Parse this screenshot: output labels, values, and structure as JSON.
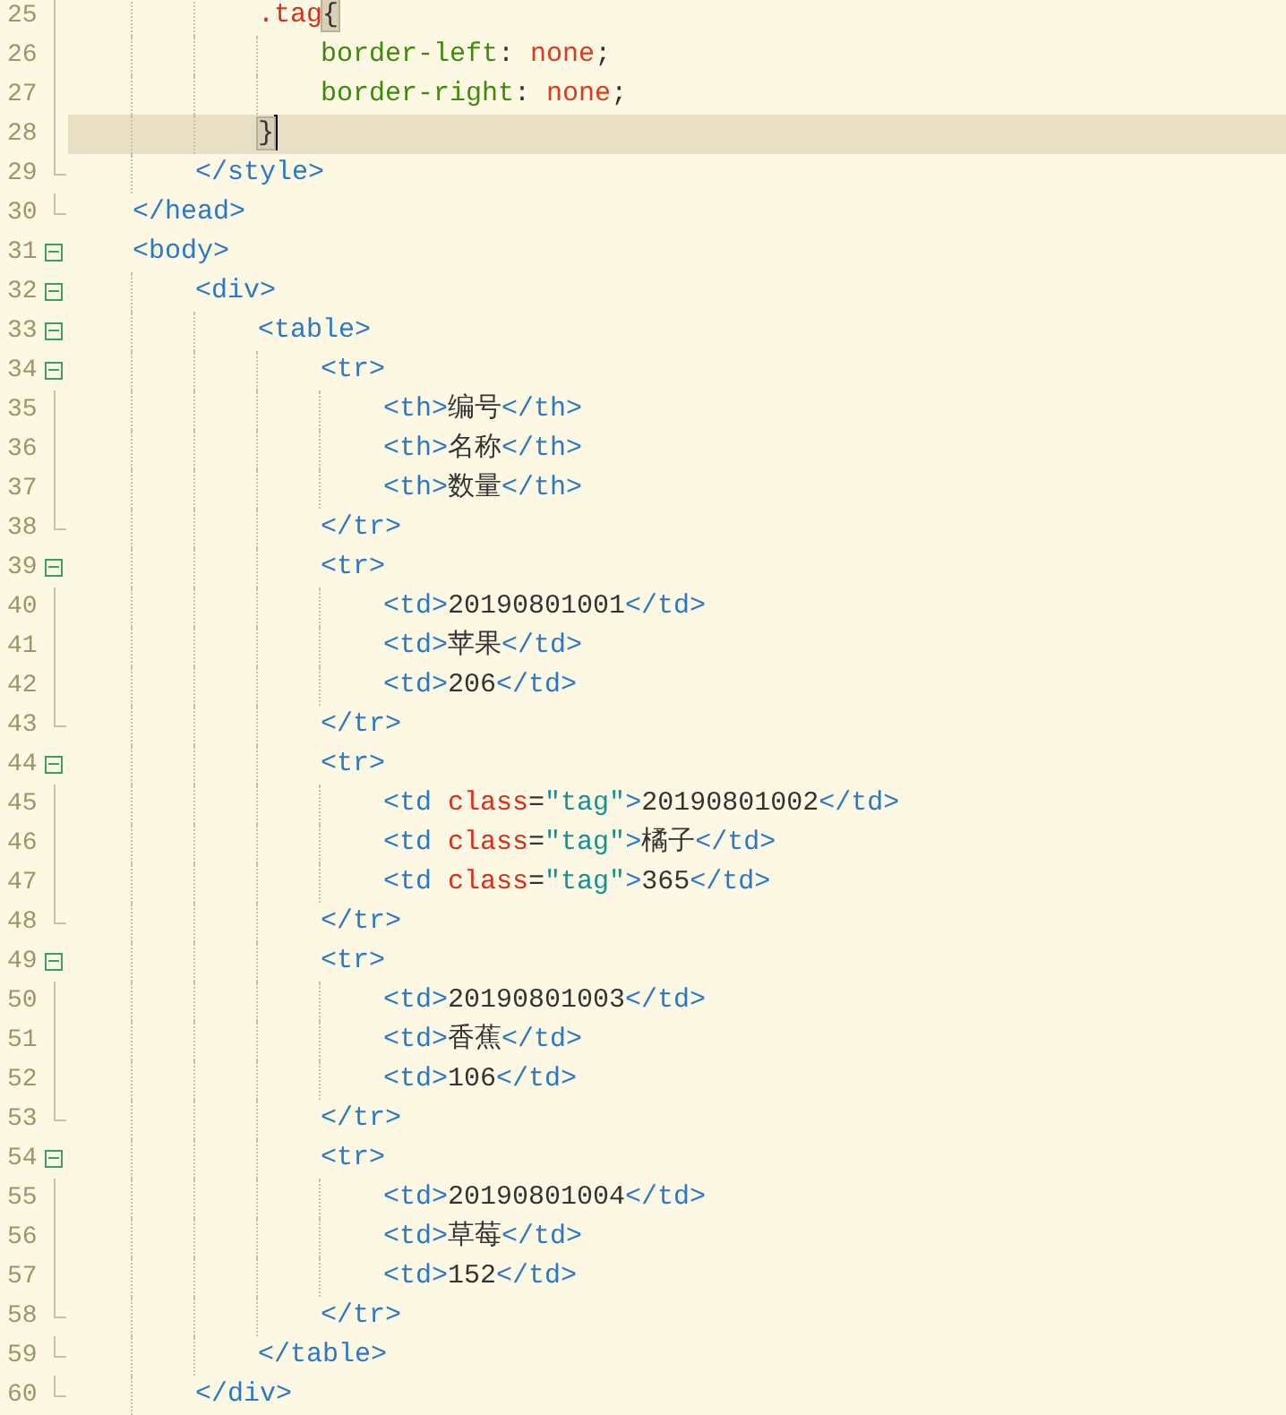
{
  "editor": {
    "lines": [
      {
        "children": [
          {
            "children": [
              {
                "number": "25",
                "kind": "fold-body",
                "current": false,
                "tokens": [
                  {
                    "kind": "selector",
                    "text": ".tag"
                  },
                  {
                    "kind": "match",
                    "text": "{"
                  }
                ],
                "children": [
                  {
                    "number": "26",
                    "kind": "fold-body",
                    "current": false,
                    "tokens": [
                      {
                        "kind": "property",
                        "text": "border-left"
                      },
                      {
                        "kind": "plain",
                        "text": ": "
                      },
                      {
                        "kind": "value",
                        "text": "none"
                      },
                      {
                        "kind": "plain",
                        "text": ";"
                      }
                    ]
                  },
                  {
                    "number": "27",
                    "kind": "fold-body",
                    "current": false,
                    "tokens": [
                      {
                        "kind": "property",
                        "text": "border-right"
                      },
                      {
                        "kind": "plain",
                        "text": ": "
                      },
                      {
                        "kind": "value",
                        "text": "none"
                      },
                      {
                        "kind": "plain",
                        "text": ";"
                      }
                    ]
                  }
                ]
              },
              {
                "number": "28",
                "kind": "fold-body",
                "current": true,
                "tokens": [
                  {
                    "kind": "match",
                    "text": "}"
                  }
                ]
              }
            ]
          },
          {
            "number": "29",
            "kind": "fold-end",
            "current": false,
            "tokens": [
              {
                "kind": "tag",
                "text": "</style>"
              }
            ]
          }
        ]
      },
      {
        "number": "30",
        "kind": "fold-end",
        "current": false,
        "tokens": [
          {
            "kind": "tag",
            "text": "</head>"
          }
        ]
      },
      {
        "number": "31",
        "kind": "fold-start",
        "current": false,
        "tokens": [
          {
            "kind": "tag",
            "text": "<body>"
          }
        ],
        "children": [
          {
            "number": "32",
            "kind": "fold-start",
            "current": false,
            "tokens": [
              {
                "kind": "tag",
                "text": "<div>"
              }
            ],
            "children": [
              {
                "number": "33",
                "kind": "fold-start",
                "current": false,
                "tokens": [
                  {
                    "kind": "tag",
                    "text": "<table>"
                  }
                ],
                "children": [
                  {
                    "number": "34",
                    "kind": "fold-start",
                    "current": false,
                    "tokens": [
                      {
                        "kind": "tag",
                        "text": "<tr>"
                      }
                    ],
                    "children": [
                      {
                        "number": "35",
                        "kind": "fold-body",
                        "current": false,
                        "tokens": [
                          {
                            "kind": "tag",
                            "text": "<th>"
                          },
                          {
                            "kind": "plain",
                            "text": "编号"
                          },
                          {
                            "kind": "tag",
                            "text": "</th>"
                          }
                        ]
                      },
                      {
                        "number": "36",
                        "kind": "fold-body",
                        "current": false,
                        "tokens": [
                          {
                            "kind": "tag",
                            "text": "<th>"
                          },
                          {
                            "kind": "plain",
                            "text": "名称"
                          },
                          {
                            "kind": "tag",
                            "text": "</th>"
                          }
                        ]
                      },
                      {
                        "number": "37",
                        "kind": "fold-body",
                        "current": false,
                        "tokens": [
                          {
                            "kind": "tag",
                            "text": "<th>"
                          },
                          {
                            "kind": "plain",
                            "text": "数量"
                          },
                          {
                            "kind": "tag",
                            "text": "</th>"
                          }
                        ]
                      }
                    ]
                  },
                  {
                    "number": "38",
                    "kind": "fold-end",
                    "current": false,
                    "tokens": [
                      {
                        "kind": "tag",
                        "text": "</tr>"
                      }
                    ]
                  },
                  {
                    "number": "39",
                    "kind": "fold-start",
                    "current": false,
                    "tokens": [
                      {
                        "kind": "tag",
                        "text": "<tr>"
                      }
                    ],
                    "children": [
                      {
                        "number": "40",
                        "kind": "fold-body",
                        "current": false,
                        "tokens": [
                          {
                            "kind": "tag",
                            "text": "<td>"
                          },
                          {
                            "kind": "plain",
                            "text": "20190801001"
                          },
                          {
                            "kind": "tag",
                            "text": "</td>"
                          }
                        ]
                      },
                      {
                        "number": "41",
                        "kind": "fold-body",
                        "current": false,
                        "tokens": [
                          {
                            "kind": "tag",
                            "text": "<td>"
                          },
                          {
                            "kind": "plain",
                            "text": "苹果"
                          },
                          {
                            "kind": "tag",
                            "text": "</td>"
                          }
                        ]
                      },
                      {
                        "number": "42",
                        "kind": "fold-body",
                        "current": false,
                        "tokens": [
                          {
                            "kind": "tag",
                            "text": "<td>"
                          },
                          {
                            "kind": "plain",
                            "text": "206"
                          },
                          {
                            "kind": "tag",
                            "text": "</td>"
                          }
                        ]
                      }
                    ]
                  },
                  {
                    "number": "43",
                    "kind": "fold-end",
                    "current": false,
                    "tokens": [
                      {
                        "kind": "tag",
                        "text": "</tr>"
                      }
                    ]
                  },
                  {
                    "number": "44",
                    "kind": "fold-start",
                    "current": false,
                    "tokens": [
                      {
                        "kind": "tag",
                        "text": "<tr>"
                      }
                    ],
                    "children": [
                      {
                        "number": "45",
                        "kind": "fold-body",
                        "current": false,
                        "tokens": [
                          {
                            "kind": "tag",
                            "text": "<td"
                          },
                          {
                            "kind": "attr",
                            "text": " class"
                          },
                          {
                            "kind": "plain",
                            "text": "="
                          },
                          {
                            "kind": "string",
                            "text": "\"tag\""
                          },
                          {
                            "kind": "tag",
                            "text": ">"
                          },
                          {
                            "kind": "plain",
                            "text": "20190801002"
                          },
                          {
                            "kind": "tag",
                            "text": "</td>"
                          }
                        ]
                      },
                      {
                        "number": "46",
                        "kind": "fold-body",
                        "current": false,
                        "tokens": [
                          {
                            "kind": "tag",
                            "text": "<td"
                          },
                          {
                            "kind": "attr",
                            "text": " class"
                          },
                          {
                            "kind": "plain",
                            "text": "="
                          },
                          {
                            "kind": "string",
                            "text": "\"tag\""
                          },
                          {
                            "kind": "tag",
                            "text": ">"
                          },
                          {
                            "kind": "plain",
                            "text": "橘子"
                          },
                          {
                            "kind": "tag",
                            "text": "</td>"
                          }
                        ]
                      },
                      {
                        "number": "47",
                        "kind": "fold-body",
                        "current": false,
                        "tokens": [
                          {
                            "kind": "tag",
                            "text": "<td"
                          },
                          {
                            "kind": "attr",
                            "text": " class"
                          },
                          {
                            "kind": "plain",
                            "text": "="
                          },
                          {
                            "kind": "string",
                            "text": "\"tag\""
                          },
                          {
                            "kind": "tag",
                            "text": ">"
                          },
                          {
                            "kind": "plain",
                            "text": "365"
                          },
                          {
                            "kind": "tag",
                            "text": "</td>"
                          }
                        ]
                      }
                    ]
                  },
                  {
                    "number": "48",
                    "kind": "fold-end",
                    "current": false,
                    "tokens": [
                      {
                        "kind": "tag",
                        "text": "</tr>"
                      }
                    ]
                  },
                  {
                    "number": "49",
                    "kind": "fold-start",
                    "current": false,
                    "tokens": [
                      {
                        "kind": "tag",
                        "text": "<tr>"
                      }
                    ],
                    "children": [
                      {
                        "number": "50",
                        "kind": "fold-body",
                        "current": false,
                        "tokens": [
                          {
                            "kind": "tag",
                            "text": "<td>"
                          },
                          {
                            "kind": "plain",
                            "text": "20190801003"
                          },
                          {
                            "kind": "tag",
                            "text": "</td>"
                          }
                        ]
                      },
                      {
                        "number": "51",
                        "kind": "fold-body",
                        "current": false,
                        "tokens": [
                          {
                            "kind": "tag",
                            "text": "<td>"
                          },
                          {
                            "kind": "plain",
                            "text": "香蕉"
                          },
                          {
                            "kind": "tag",
                            "text": "</td>"
                          }
                        ]
                      },
                      {
                        "number": "52",
                        "kind": "fold-body",
                        "current": false,
                        "tokens": [
                          {
                            "kind": "tag",
                            "text": "<td>"
                          },
                          {
                            "kind": "plain",
                            "text": "106"
                          },
                          {
                            "kind": "tag",
                            "text": "</td>"
                          }
                        ]
                      }
                    ]
                  },
                  {
                    "number": "53",
                    "kind": "fold-end",
                    "current": false,
                    "tokens": [
                      {
                        "kind": "tag",
                        "text": "</tr>"
                      }
                    ]
                  },
                  {
                    "number": "54",
                    "kind": "fold-start",
                    "current": false,
                    "tokens": [
                      {
                        "kind": "tag",
                        "text": "<tr>"
                      }
                    ],
                    "children": [
                      {
                        "number": "55",
                        "kind": "fold-body",
                        "current": false,
                        "tokens": [
                          {
                            "kind": "tag",
                            "text": "<td>"
                          },
                          {
                            "kind": "plain",
                            "text": "20190801004"
                          },
                          {
                            "kind": "tag",
                            "text": "</td>"
                          }
                        ]
                      },
                      {
                        "number": "56",
                        "kind": "fold-body",
                        "current": false,
                        "tokens": [
                          {
                            "kind": "tag",
                            "text": "<td>"
                          },
                          {
                            "kind": "plain",
                            "text": "草莓"
                          },
                          {
                            "kind": "tag",
                            "text": "</td>"
                          }
                        ]
                      },
                      {
                        "number": "57",
                        "kind": "fold-body",
                        "current": false,
                        "tokens": [
                          {
                            "kind": "tag",
                            "text": "<td>"
                          },
                          {
                            "kind": "plain",
                            "text": "152"
                          },
                          {
                            "kind": "tag",
                            "text": "</td>"
                          }
                        ]
                      }
                    ]
                  },
                  {
                    "number": "58",
                    "kind": "fold-end",
                    "current": false,
                    "tokens": [
                      {
                        "kind": "tag",
                        "text": "</tr>"
                      }
                    ]
                  }
                ]
              },
              {
                "number": "59",
                "kind": "fold-end",
                "current": false,
                "tokens": [
                  {
                    "kind": "tag",
                    "text": "</table>"
                  }
                ]
              }
            ]
          },
          {
            "number": "60",
            "kind": "fold-end",
            "current": false,
            "tokens": [
              {
                "kind": "tag",
                "text": "</div>"
              }
            ]
          }
        ]
      }
    ]
  }
}
